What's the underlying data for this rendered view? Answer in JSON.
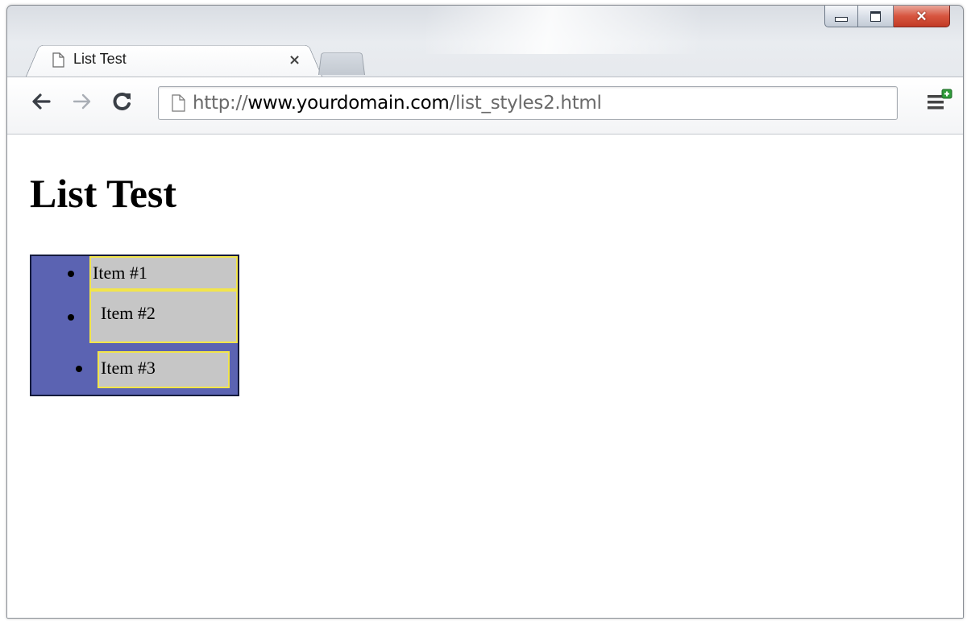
{
  "browser": {
    "tab_title": "List Test",
    "tab_close_glyph": "×",
    "url_scheme": "http://",
    "url_host": "www.yourdomain.com",
    "url_path": "/list_styles2.html"
  },
  "window_controls": {
    "close_glyph": "✕"
  },
  "page": {
    "heading": "List Test",
    "list_items": [
      "Item #1",
      "Item #2",
      "Item #3"
    ]
  },
  "colors": {
    "list_background": "#5b63b2",
    "list_border": "#141a3c",
    "item_background": "#c6c6c6",
    "item_border": "#f2e54a"
  },
  "icons": [
    "page-icon",
    "back-arrow-icon",
    "forward-arrow-icon",
    "reload-icon",
    "chrome-menu-icon",
    "minimize-icon",
    "maximize-icon",
    "close-icon"
  ]
}
